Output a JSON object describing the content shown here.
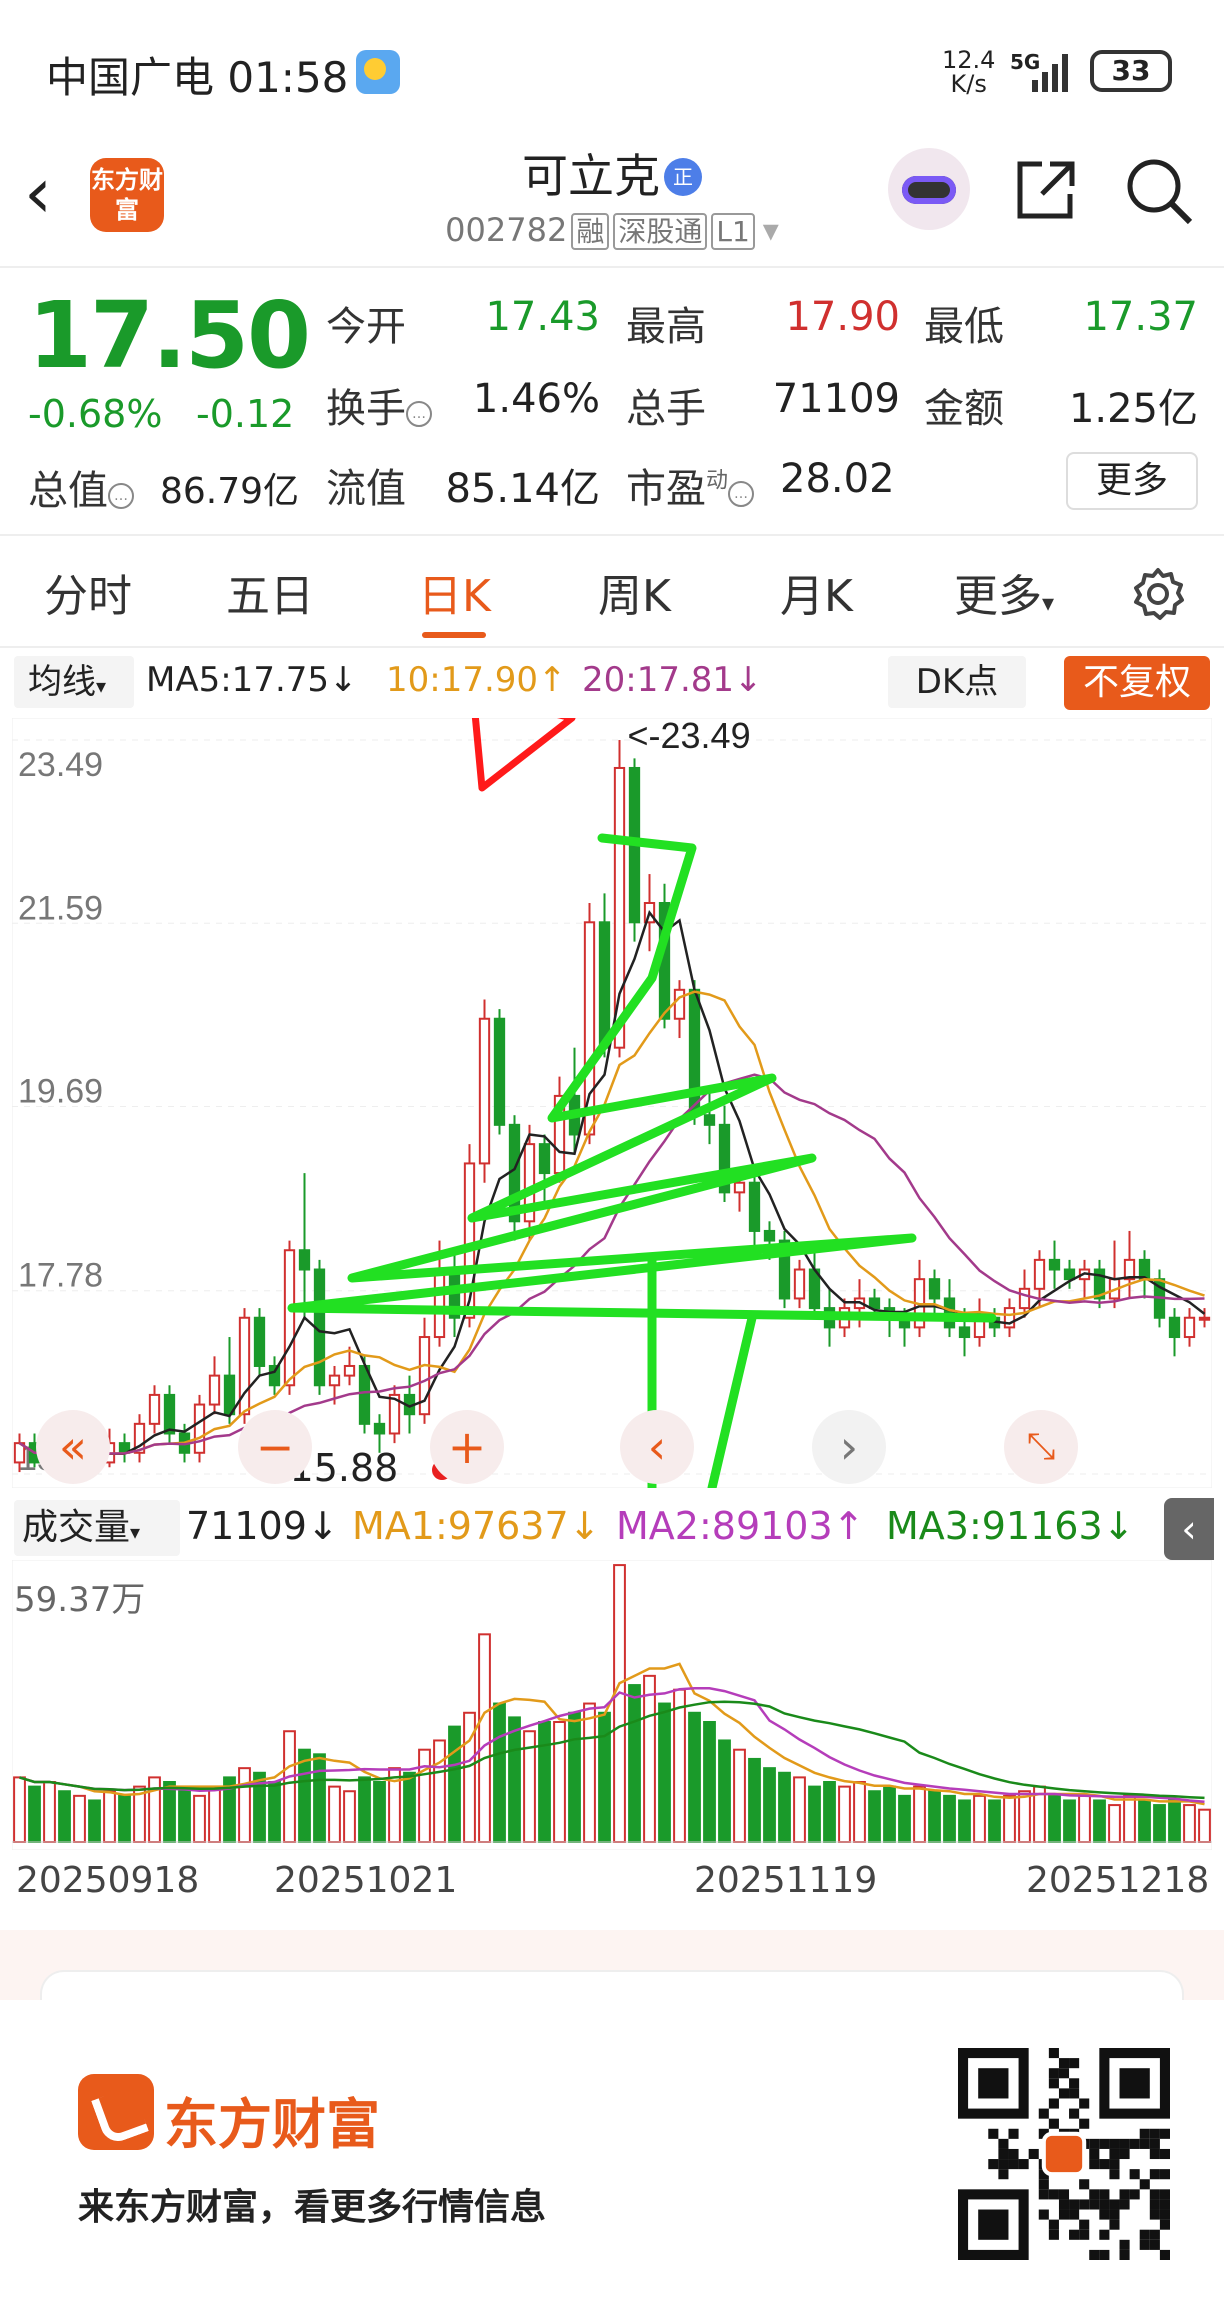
{
  "status_bar": {
    "carrier_time": "中国广电 01:58",
    "net_speed_top": "12.4",
    "net_speed_bottom": "K/s",
    "signal": "5G",
    "battery": "33"
  },
  "header": {
    "stock_name": "可立克",
    "name_badge": "正",
    "code": "002782",
    "tags": [
      "融",
      "深股通",
      "L1"
    ],
    "logo_text": "东方财富"
  },
  "quote": {
    "price": "17.50",
    "change_pct": "-0.68%",
    "change_abs": "-0.12",
    "open_label": "今开",
    "open": "17.43",
    "high_label": "最高",
    "high": "17.90",
    "low_label": "最低",
    "low": "17.37",
    "turnover_label": "换手",
    "turnover": "1.46%",
    "volume_label": "总手",
    "volume": "71109",
    "amount_label": "金额",
    "amount": "1.25亿",
    "total_cap_label": "总值",
    "total_cap": "86.79亿",
    "float_cap_label": "流值",
    "float_cap": "85.14亿",
    "pe_label": "市盈",
    "pe_sup": "动",
    "pe": "28.02",
    "more": "更多"
  },
  "tabs": [
    "分时",
    "五日",
    "日K",
    "周K",
    "月K",
    "更多"
  ],
  "ma_legend": {
    "select": "均线",
    "ma5": "MA5:17.75↓",
    "ma10": "10:17.90↑",
    "ma20": "20:17.81↓",
    "dk": "DK点",
    "adjust": "不复权"
  },
  "chart_data": [
    {
      "type": "candlestick",
      "y_ticks": [
        "23.49",
        "21.59",
        "19.69",
        "17.78",
        "15.88"
      ],
      "ylim": [
        15.88,
        23.49
      ],
      "max_marker": "<-23.49",
      "min_marker": "<-15.88",
      "candles": [
        [
          16.0,
          16.2,
          15.9,
          16.3
        ],
        [
          16.2,
          16.0,
          15.95,
          16.3
        ],
        [
          16.0,
          16.1,
          15.9,
          16.25
        ],
        [
          16.1,
          16.0,
          15.9,
          16.2
        ],
        [
          16.0,
          16.15,
          15.95,
          16.3
        ],
        [
          16.15,
          16.0,
          15.9,
          16.2
        ],
        [
          16.0,
          16.2,
          15.95,
          16.35
        ],
        [
          16.2,
          16.1,
          16.0,
          16.3
        ],
        [
          16.1,
          16.4,
          16.0,
          16.5
        ],
        [
          16.4,
          16.7,
          16.3,
          16.8
        ],
        [
          16.7,
          16.3,
          16.2,
          16.8
        ],
        [
          16.3,
          16.1,
          16.0,
          16.4
        ],
        [
          16.1,
          16.6,
          16.0,
          16.7
        ],
        [
          16.6,
          16.9,
          16.5,
          17.1
        ],
        [
          16.9,
          16.5,
          16.4,
          17.3
        ],
        [
          16.5,
          17.5,
          16.4,
          17.6
        ],
        [
          17.5,
          17.0,
          16.9,
          17.6
        ],
        [
          17.0,
          16.8,
          16.7,
          17.1
        ],
        [
          16.8,
          18.2,
          16.7,
          18.3
        ],
        [
          18.2,
          18.0,
          17.5,
          19.0
        ],
        [
          18.0,
          16.8,
          16.7,
          18.1
        ],
        [
          16.8,
          16.9,
          16.6,
          17.0
        ],
        [
          16.9,
          17.0,
          16.8,
          17.2
        ],
        [
          17.0,
          16.4,
          16.3,
          17.1
        ],
        [
          16.4,
          16.3,
          16.1,
          16.5
        ],
        [
          16.3,
          16.7,
          16.2,
          16.8
        ],
        [
          16.7,
          16.5,
          16.3,
          16.9
        ],
        [
          16.5,
          17.3,
          16.4,
          17.5
        ],
        [
          17.3,
          18.0,
          17.2,
          18.3
        ],
        [
          18.0,
          17.5,
          17.3,
          18.2
        ],
        [
          17.5,
          19.1,
          17.4,
          19.3
        ],
        [
          19.1,
          20.6,
          18.9,
          20.8
        ],
        [
          20.6,
          19.5,
          19.4,
          20.7
        ],
        [
          19.5,
          18.5,
          18.3,
          19.6
        ],
        [
          18.5,
          19.3,
          18.3,
          19.5
        ],
        [
          19.3,
          19.0,
          18.7,
          19.4
        ],
        [
          19.0,
          19.8,
          18.9,
          20.0
        ],
        [
          19.8,
          19.4,
          19.2,
          20.3
        ],
        [
          19.4,
          21.6,
          19.3,
          21.8
        ],
        [
          21.6,
          20.3,
          20.2,
          21.9
        ],
        [
          20.3,
          23.2,
          20.2,
          23.49
        ],
        [
          23.2,
          21.6,
          21.4,
          23.3
        ],
        [
          21.6,
          21.8,
          21.3,
          22.1
        ],
        [
          21.8,
          20.6,
          20.5,
          22.0
        ],
        [
          20.6,
          20.9,
          20.4,
          21.0
        ],
        [
          20.9,
          19.6,
          19.5,
          21.0
        ],
        [
          19.6,
          19.5,
          19.3,
          19.9
        ],
        [
          19.5,
          18.8,
          18.7,
          19.7
        ],
        [
          18.8,
          18.9,
          18.6,
          19.0
        ],
        [
          18.9,
          18.4,
          18.2,
          19.0
        ],
        [
          18.4,
          18.3,
          18.1,
          18.5
        ],
        [
          18.3,
          17.7,
          17.6,
          18.4
        ],
        [
          17.7,
          18.0,
          17.6,
          18.1
        ],
        [
          18.0,
          17.6,
          17.5,
          18.2
        ],
        [
          17.6,
          17.4,
          17.2,
          17.8
        ],
        [
          17.4,
          17.6,
          17.3,
          17.7
        ],
        [
          17.6,
          17.7,
          17.4,
          17.9
        ],
        [
          17.7,
          17.6,
          17.5,
          17.8
        ],
        [
          17.6,
          17.5,
          17.3,
          17.7
        ],
        [
          17.5,
          17.4,
          17.2,
          17.6
        ],
        [
          17.4,
          17.9,
          17.3,
          18.1
        ],
        [
          17.9,
          17.7,
          17.5,
          18.0
        ],
        [
          17.7,
          17.4,
          17.3,
          17.9
        ],
        [
          17.4,
          17.3,
          17.1,
          17.6
        ],
        [
          17.3,
          17.5,
          17.2,
          17.7
        ],
        [
          17.5,
          17.4,
          17.3,
          17.6
        ],
        [
          17.4,
          17.6,
          17.3,
          17.7
        ],
        [
          17.6,
          17.8,
          17.5,
          18.0
        ],
        [
          17.8,
          18.1,
          17.6,
          18.2
        ],
        [
          18.1,
          18.0,
          17.8,
          18.3
        ],
        [
          18.0,
          17.9,
          17.8,
          18.1
        ],
        [
          17.9,
          18.0,
          17.7,
          18.1
        ],
        [
          18.0,
          17.7,
          17.6,
          18.1
        ],
        [
          17.7,
          17.9,
          17.6,
          18.3
        ],
        [
          17.9,
          18.1,
          17.7,
          18.4
        ],
        [
          18.1,
          17.9,
          17.7,
          18.2
        ],
        [
          17.9,
          17.5,
          17.4,
          18.0
        ],
        [
          17.5,
          17.3,
          17.1,
          17.6
        ],
        [
          17.3,
          17.5,
          17.2,
          17.6
        ],
        [
          17.5,
          17.5,
          17.4,
          17.6
        ]
      ]
    },
    {
      "type": "bar",
      "y_max_label": "59.37万",
      "ylim": [
        0,
        59.37
      ],
      "x_ticks": [
        "20250918",
        "20251021",
        "20251119",
        "20251218"
      ],
      "values": [
        14,
        12,
        13,
        11,
        10,
        9,
        11,
        10,
        12,
        14,
        13,
        11,
        10,
        12,
        14,
        16,
        15,
        13,
        24,
        20,
        19,
        12,
        11,
        14,
        13,
        16,
        15,
        20,
        22,
        25,
        28,
        45,
        30,
        27,
        24,
        26,
        26,
        28,
        30,
        28,
        60,
        34,
        36,
        30,
        33,
        28,
        26,
        22,
        20,
        18,
        16,
        15,
        14,
        12,
        13,
        12,
        13,
        11,
        12,
        10,
        12,
        11,
        10,
        9,
        10,
        9,
        10,
        11,
        12,
        10,
        9,
        10,
        9,
        8,
        10,
        9,
        8,
        9,
        8,
        7
      ]
    }
  ],
  "volume_legend": {
    "select": "成交量",
    "value": "71109↓",
    "ma1": "MA1:97637↓",
    "ma2": "MA2:89103↑",
    "ma3": "MA3:91163↓"
  },
  "chart_controls": {
    "zoom_out": "−",
    "zoom_in": "+",
    "prev": "‹",
    "next": "›"
  },
  "footer": {
    "brand": "东方财富",
    "slogan": "来东方财富，看更多行情信息"
  },
  "colors": {
    "up": "#d0302f",
    "down": "#1a9a2a",
    "accent": "#e85a1b",
    "ma5": "#222222",
    "ma10": "#e29a1a",
    "ma20": "#a33a8b",
    "annotation": "#22e022",
    "star": "#ff1a1a"
  }
}
